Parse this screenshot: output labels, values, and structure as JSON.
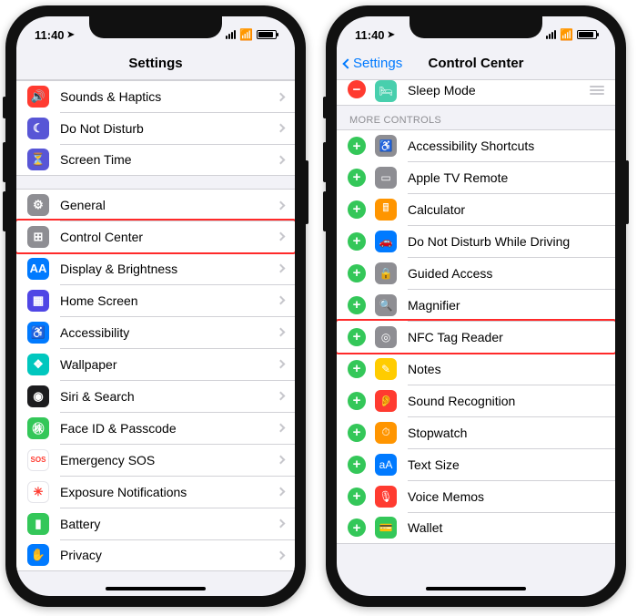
{
  "status": {
    "time": "11:40",
    "loc_icon": "➤"
  },
  "left": {
    "title": "Settings",
    "rows": [
      {
        "label": "Sounds & Haptics",
        "color": "#ff3b30",
        "glyph": "🔊"
      },
      {
        "label": "Do Not Disturb",
        "color": "#5856d6",
        "glyph": "☾"
      },
      {
        "label": "Screen Time",
        "color": "#5856d6",
        "glyph": "⏳"
      }
    ],
    "rows2": [
      {
        "label": "General",
        "color": "#8e8e93",
        "glyph": "⚙"
      },
      {
        "label": "Control Center",
        "color": "#8e8e93",
        "glyph": "⊞",
        "hl": true
      },
      {
        "label": "Display & Brightness",
        "color": "#007aff",
        "glyph": "AA"
      },
      {
        "label": "Home Screen",
        "color": "#4f46e5",
        "glyph": "▦"
      },
      {
        "label": "Accessibility",
        "color": "#007aff",
        "glyph": "♿"
      },
      {
        "label": "Wallpaper",
        "color": "#00c7be",
        "glyph": "❖"
      },
      {
        "label": "Siri & Search",
        "color": "#1c1c1e",
        "glyph": "◉"
      },
      {
        "label": "Face ID & Passcode",
        "color": "#34c759",
        "glyph": "㊑"
      },
      {
        "label": "Emergency SOS",
        "color": "#ffffff",
        "glyph": "SOS",
        "textColor": "#ff3b30"
      },
      {
        "label": "Exposure Notifications",
        "color": "#ffffff",
        "glyph": "✳",
        "textColor": "#ff3b30"
      },
      {
        "label": "Battery",
        "color": "#34c759",
        "glyph": "▮"
      },
      {
        "label": "Privacy",
        "color": "#007aff",
        "glyph": "✋"
      }
    ]
  },
  "right": {
    "back": "Settings",
    "title": "Control Center",
    "included_last": {
      "label": "Sleep Mode",
      "color": "#48cfad",
      "glyph": "🛏",
      "minus": true
    },
    "header": "More Controls",
    "more": [
      {
        "label": "Accessibility Shortcuts",
        "color": "#8e8e93",
        "glyph": "♿"
      },
      {
        "label": "Apple TV Remote",
        "color": "#8e8e93",
        "glyph": "▭"
      },
      {
        "label": "Calculator",
        "color": "#ff9500",
        "glyph": "🖩"
      },
      {
        "label": "Do Not Disturb While Driving",
        "color": "#007aff",
        "glyph": "🚗"
      },
      {
        "label": "Guided Access",
        "color": "#8e8e93",
        "glyph": "🔒"
      },
      {
        "label": "Magnifier",
        "color": "#8e8e93",
        "glyph": "🔍"
      },
      {
        "label": "NFC Tag Reader",
        "color": "#8e8e93",
        "glyph": "◎",
        "hl": true
      },
      {
        "label": "Notes",
        "color": "#ffcc00",
        "glyph": "✎"
      },
      {
        "label": "Sound Recognition",
        "color": "#ff3b30",
        "glyph": "👂"
      },
      {
        "label": "Stopwatch",
        "color": "#ff9500",
        "glyph": "⏱"
      },
      {
        "label": "Text Size",
        "color": "#007aff",
        "glyph": "aA"
      },
      {
        "label": "Voice Memos",
        "color": "#ff3b30",
        "glyph": "🎙"
      },
      {
        "label": "Wallet",
        "color": "#34c759",
        "glyph": "💳"
      }
    ]
  }
}
